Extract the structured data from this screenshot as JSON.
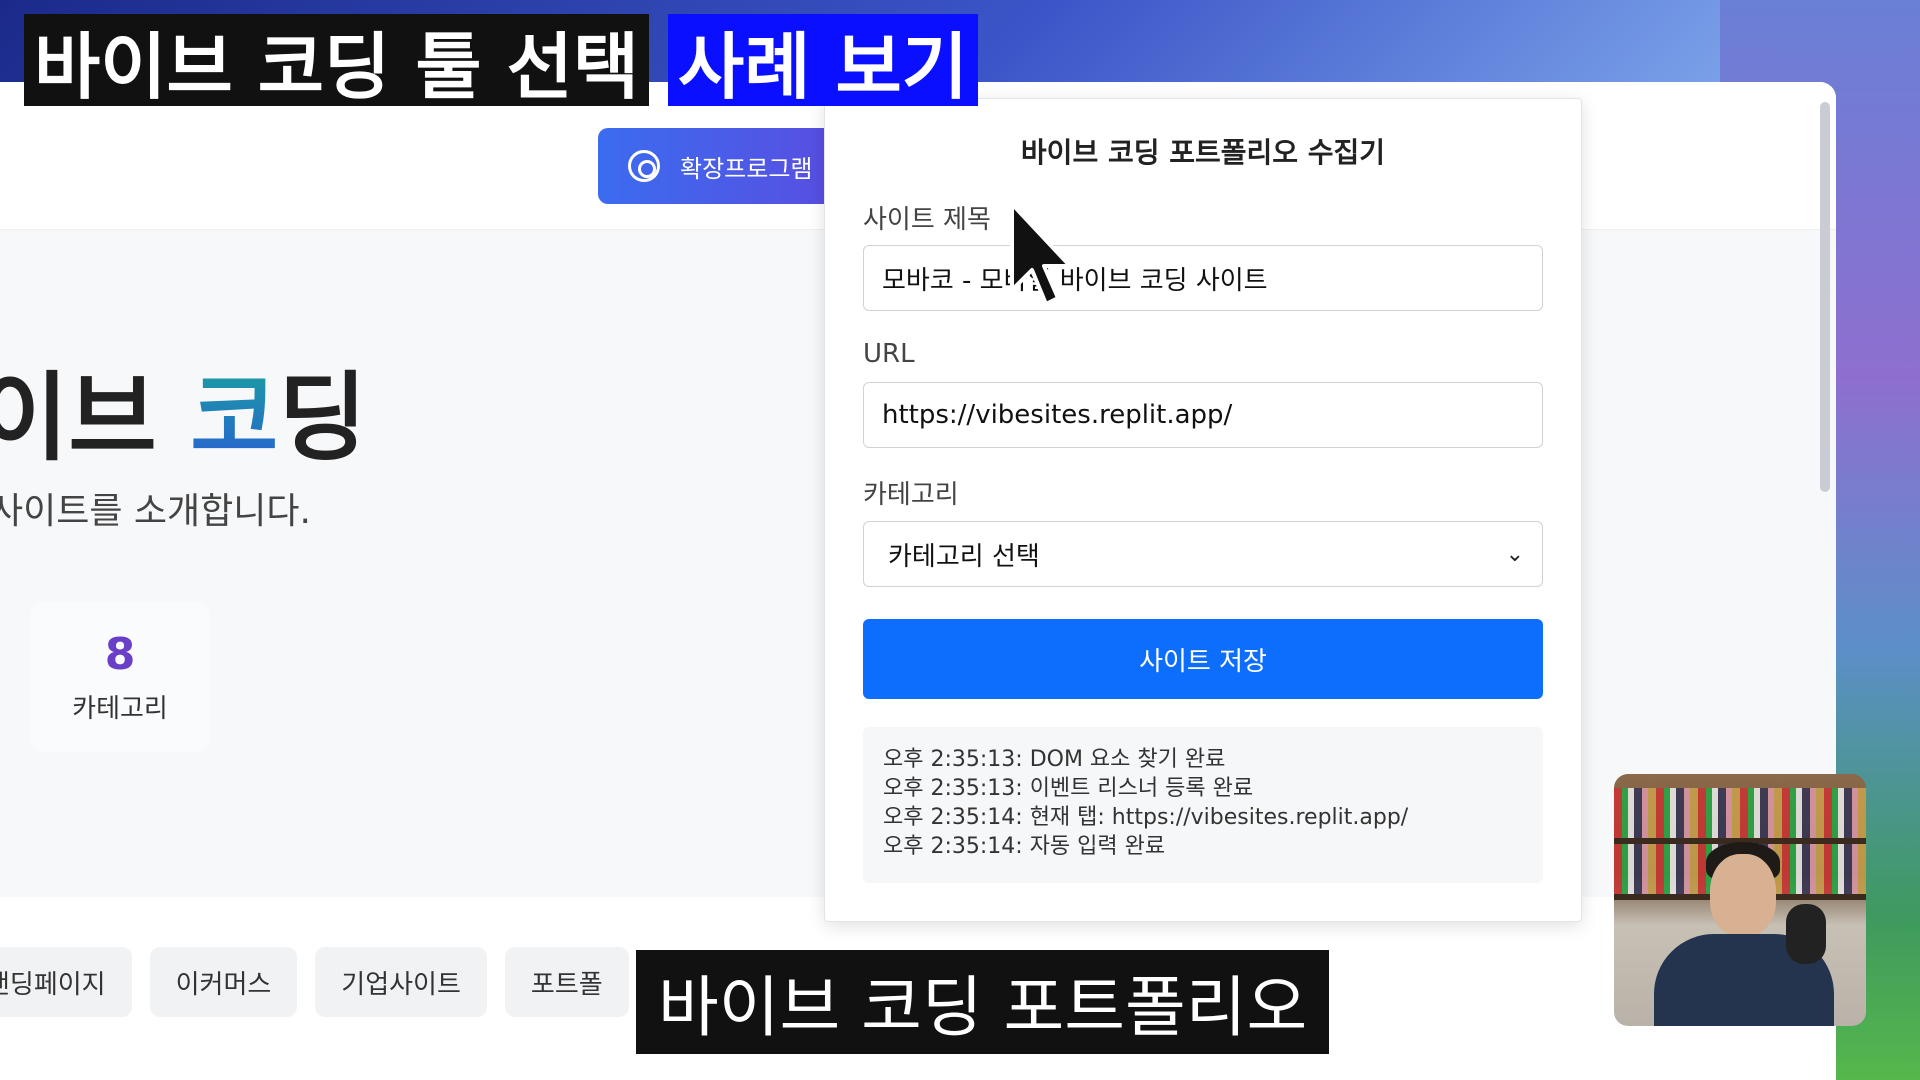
{
  "captions": {
    "top_left": "바이브 코딩 툴 선택",
    "top_highlight": "사례 보기",
    "bottom": "바이브 코딩 포트폴리오"
  },
  "page": {
    "extension_button": "확장프로그램",
    "hero_title_prefix": "이브 ",
    "hero_title_accent": "코",
    "hero_title_suffix": "딩",
    "hero_subtitle": "사이트를 소개합니다.",
    "stat": {
      "number": "8",
      "label": "카테고리"
    },
    "filters": [
      "랜딩페이지",
      "이커머스",
      "기업사이트",
      "포트폴"
    ]
  },
  "popup": {
    "title": "바이브 코딩 포트폴리오 수집기",
    "site_title_label": "사이트 제목",
    "site_title_value": "모바코 - 모바일 바이브 코딩 사이트",
    "url_label": "URL",
    "url_value": "https://vibesites.replit.app/",
    "category_label": "카테고리",
    "category_value": "카테고리 선택",
    "save_button": "사이트 저장",
    "log": [
      "오후 2:35:13: DOM 요소 찾기 완료",
      "오후 2:35:13: 이벤트 리스너 등록 완료",
      "오후 2:35:14: 현재 탭: https://vibesites.replit.app/",
      "오후 2:35:14: 자동 입력 완료"
    ]
  },
  "colors": {
    "primary": "#0d6efd",
    "stat_number": "#6a3fc8",
    "caption_highlight": "#0a10ff"
  }
}
